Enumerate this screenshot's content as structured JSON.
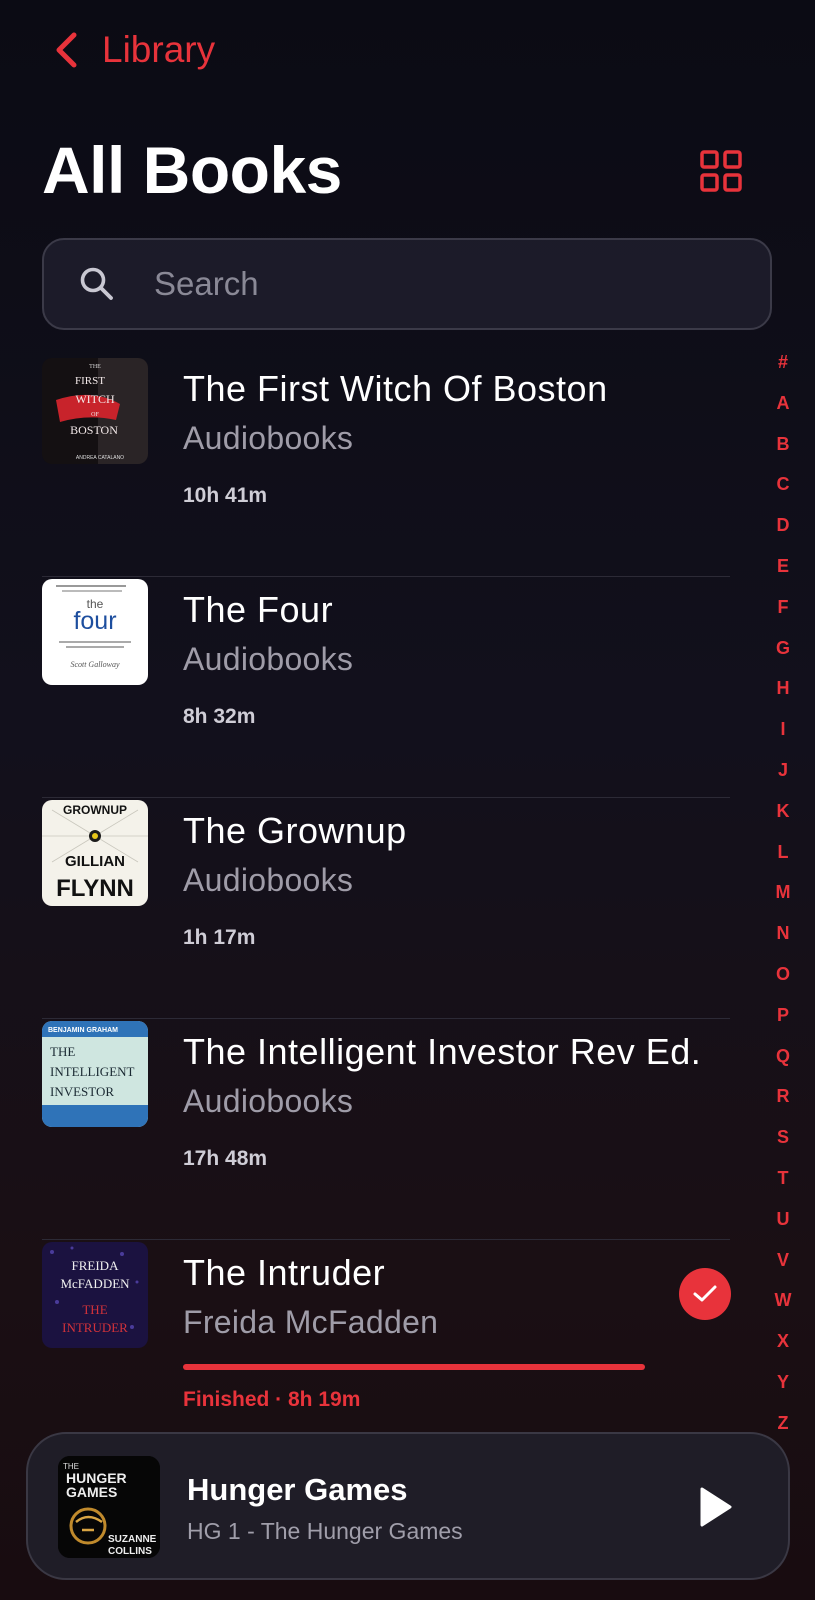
{
  "nav": {
    "back_label": "Library"
  },
  "header": {
    "title": "All Books"
  },
  "search": {
    "placeholder": "Search"
  },
  "books": [
    {
      "title": "The First Witch Of Boston",
      "subtitle": "Audiobooks",
      "duration": "10h 41m"
    },
    {
      "title": "The Four",
      "subtitle": "Audiobooks",
      "duration": "8h 32m"
    },
    {
      "title": "The Grownup",
      "subtitle": "Audiobooks",
      "duration": "1h 17m"
    },
    {
      "title": "The Intelligent Investor Rev Ed.",
      "subtitle": "Audiobooks",
      "duration": "17h 48m"
    },
    {
      "title": "The Intruder",
      "subtitle": "Freida McFadden",
      "status": "Finished · 8h 19m",
      "progress": 1.0,
      "finished": true
    }
  ],
  "covers": {
    "witch": [
      "THE",
      "FIRST",
      "WITCH",
      "OF",
      "BOSTON",
      "ANDREA CATALANO"
    ],
    "four": [
      "the",
      "four",
      "Scott Galloway"
    ],
    "grownup": [
      "GROWNUP",
      "GILLIAN",
      "FLYNN"
    ],
    "investor": [
      "BENJAMIN GRAHAM",
      "THE",
      "INTELLIGENT",
      "INVESTOR"
    ],
    "intruder": [
      "FREIDA",
      "McFADDEN",
      "THE",
      "INTRUDER"
    ],
    "hunger": [
      "THE",
      "HUNGER",
      "GAMES",
      "SUZANNE",
      "COLLINS"
    ]
  },
  "alphabet": [
    "#",
    "A",
    "B",
    "C",
    "D",
    "E",
    "F",
    "G",
    "H",
    "I",
    "J",
    "K",
    "L",
    "M",
    "N",
    "O",
    "P",
    "Q",
    "R",
    "S",
    "T",
    "U",
    "V",
    "W",
    "X",
    "Y",
    "Z"
  ],
  "now_playing": {
    "title": "Hunger Games",
    "subtitle": "HG 1 - The Hunger Games"
  },
  "colors": {
    "accent": "#e8333b",
    "background": "#0e0d16",
    "secondary_text": "#9f9ca8"
  }
}
